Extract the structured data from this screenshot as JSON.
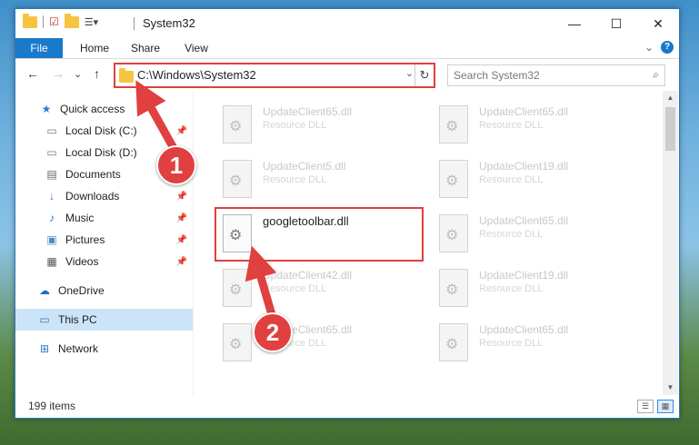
{
  "window": {
    "title": "System32",
    "caption": {
      "minimize": "—",
      "maximize": "☐",
      "close": "✕"
    }
  },
  "ribbon": {
    "tabs": [
      "File",
      "Home",
      "Share",
      "View"
    ],
    "expand": "⌄",
    "help": "?"
  },
  "nav": {
    "back": "←",
    "forward": "→",
    "recent": "⌄",
    "up": "↑",
    "address": "C:\\Windows\\System32",
    "dropdown": "⌄",
    "refresh": "↻",
    "search_placeholder": "Search System32",
    "search_icon": "⌕"
  },
  "sidebar": {
    "items": [
      {
        "label": "Quick access",
        "icon": "star-icon",
        "pinned": false
      },
      {
        "label": "Local Disk (C:)",
        "icon": "drive-icon",
        "pinned": true
      },
      {
        "label": "Local Disk (D:)",
        "icon": "drive-icon",
        "pinned": false
      },
      {
        "label": "Documents",
        "icon": "document-icon",
        "pinned": true
      },
      {
        "label": "Downloads",
        "icon": "download-icon",
        "pinned": true
      },
      {
        "label": "Music",
        "icon": "music-icon",
        "pinned": true
      },
      {
        "label": "Pictures",
        "icon": "picture-icon",
        "pinned": true
      },
      {
        "label": "Videos",
        "icon": "video-icon",
        "pinned": true
      },
      {
        "label": "OneDrive",
        "icon": "cloud-icon",
        "pinned": false
      },
      {
        "label": "This PC",
        "icon": "computer-icon",
        "pinned": false,
        "selected": true
      },
      {
        "label": "Network",
        "icon": "network-icon",
        "pinned": false
      }
    ]
  },
  "files": [
    {
      "name": "UpdateClient65.dll",
      "desc": "Resource DLL"
    },
    {
      "name": "UpdateClient65.dll",
      "desc": "Resource DLL"
    },
    {
      "name": "UpdateClient5.dll",
      "desc": "Resource DLL"
    },
    {
      "name": "UpdateClient19.dll",
      "desc": "Resource DLL"
    },
    {
      "name": "googletoolbar.dll",
      "desc": "",
      "highlighted": true
    },
    {
      "name": "UpdateClient65.dll",
      "desc": "Resource DLL"
    },
    {
      "name": "UpdateClient42.dll",
      "desc": "Resource DLL"
    },
    {
      "name": "UpdateClient19.dll",
      "desc": "Resource DLL"
    },
    {
      "name": "UpdateClient65.dll",
      "desc": "Resource DLL"
    },
    {
      "name": "UpdateClient65.dll",
      "desc": "Resource DLL"
    }
  ],
  "status": {
    "item_count": "199 items"
  },
  "annotations": {
    "step1": "1",
    "step2": "2",
    "color": "#e0403f"
  },
  "colors": {
    "accent": "#1979ca",
    "highlight": "#e0403f",
    "selection": "#cce4f7"
  }
}
